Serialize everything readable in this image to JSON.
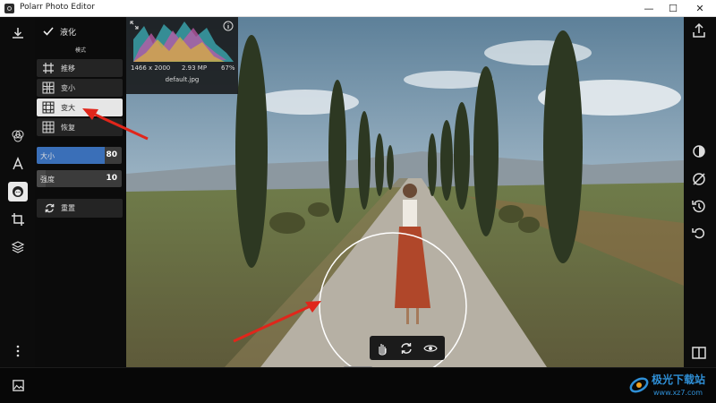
{
  "window": {
    "title": "Polarr Photo Editor",
    "controls": [
      "—",
      "☐",
      "✕"
    ]
  },
  "panel": {
    "title": "液化",
    "mode_label": "模式",
    "modes": [
      {
        "label": "推移",
        "icon": "push-grid-icon"
      },
      {
        "label": "变小",
        "icon": "shrink-grid-icon"
      },
      {
        "label": "变大",
        "icon": "enlarge-grid-icon",
        "selected": true
      },
      {
        "label": "恢复",
        "icon": "restore-grid-icon"
      }
    ],
    "sliders": [
      {
        "label": "大小",
        "value": "80",
        "level": 0.8,
        "color": "#3a6fb8"
      },
      {
        "label": "强度",
        "value": "10",
        "level": 0.1,
        "color": "#4a4a4a"
      }
    ],
    "reset_label": "重置"
  },
  "histogram": {
    "dimensions": "1466 x 2000",
    "megapixels": "2.93 MP",
    "percent": "67%",
    "filename": "default.jpg"
  },
  "watermark": {
    "main": "极光下载站",
    "sub": "www.xz7.com"
  },
  "colors": {
    "accent": "#3a6fb8",
    "annotation_arrow": "#e0261b"
  }
}
